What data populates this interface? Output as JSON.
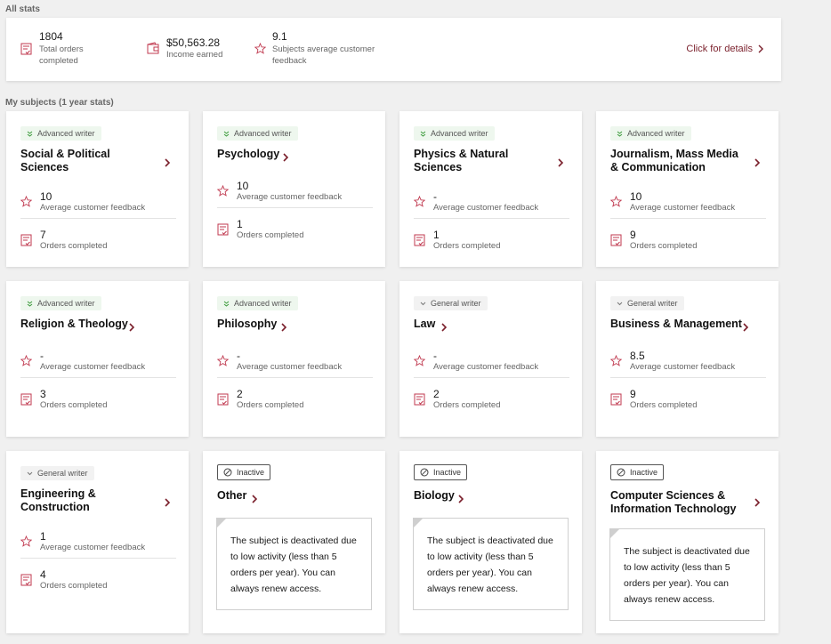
{
  "all_stats_title": "All stats",
  "my_subjects_title": "My subjects (1 year stats)",
  "stats": {
    "orders_value": "1804",
    "orders_label": "Total orders completed",
    "income_value": "$50,563.28",
    "income_label": "Income earned",
    "feedback_value": "9.1",
    "feedback_label": "Subjects average customer feedback",
    "details_link": "Click for details"
  },
  "colors": {
    "accent": "#7a1f2b",
    "icon": "#c0394f"
  },
  "labels": {
    "avg_feedback": "Average customer feedback",
    "orders_completed": "Orders completed",
    "deactivated": "The subject is deactivated due to low activity (less than 5 orders per year). You can always renew access."
  },
  "subjects": [
    {
      "badge": "Advanced writer",
      "title": "Social & Political Sciences",
      "feedback": "10",
      "orders": "7"
    },
    {
      "badge": "Advanced writer",
      "title": "Psychology",
      "feedback": "10",
      "orders": "1"
    },
    {
      "badge": "Advanced writer",
      "title": "Physics & Natural Sciences",
      "feedback": "-",
      "orders": "1"
    },
    {
      "badge": "Advanced writer",
      "title": "Journalism, Mass Media & Communication",
      "feedback": "10",
      "orders": "9"
    },
    {
      "badge": "Advanced writer",
      "title": "Religion & Theology",
      "feedback": "-",
      "orders": "3"
    },
    {
      "badge": "Advanced writer",
      "title": "Philosophy",
      "feedback": "-",
      "orders": "2"
    },
    {
      "badge": "General writer",
      "title": "Law",
      "feedback": "-",
      "orders": "2"
    },
    {
      "badge": "General writer",
      "title": "Business & Management",
      "feedback": "8.5",
      "orders": "9"
    },
    {
      "badge": "General writer",
      "title": "Engineering & Construction",
      "feedback": "1",
      "orders": "4"
    },
    {
      "badge": "Inactive",
      "title": "Other"
    },
    {
      "badge": "Inactive",
      "title": "Biology"
    },
    {
      "badge": "Inactive",
      "title": "Computer Sciences & Information Technology"
    }
  ]
}
